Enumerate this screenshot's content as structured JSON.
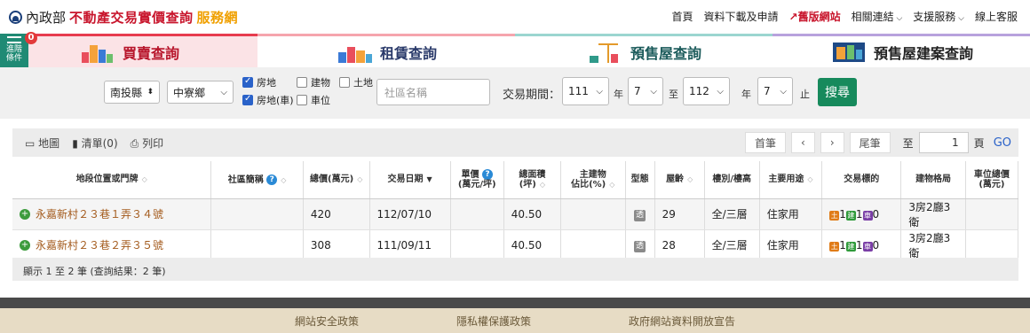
{
  "header": {
    "ministry": "內政部",
    "title": "不動產交易實價查詢",
    "title_suffix": "服務網",
    "nav": [
      "首頁",
      "資料下載及申請",
      "舊版網站",
      "相關連結",
      "支援服務",
      "線上客服"
    ]
  },
  "advanced": {
    "label_line1": "進階",
    "label_line2": "條件",
    "badge": "0"
  },
  "tabs": [
    "買賣查詢",
    "租賃查詢",
    "預售屋查詢",
    "預售屋建案查詢"
  ],
  "filters": {
    "county": "南投縣",
    "town": "中寮鄉",
    "checks": {
      "land_bld": "房地",
      "bld": "建物",
      "land": "土地",
      "land_bld_park": "房地(車)",
      "park": "車位"
    },
    "community_placeholder": "社區名稱",
    "period_label": "交易期間：",
    "from_year": "111",
    "from_month": "7",
    "to_label": "至",
    "to_year": "112",
    "to_month": "7",
    "year_unit": "年",
    "end_label": "止",
    "search": "搜尋"
  },
  "toolbar": {
    "map": "地圖",
    "list": "清單(0)",
    "print": "列印",
    "first": "首筆",
    "prev": "‹",
    "next": "›",
    "last": "尾筆",
    "to": "至",
    "page": "1",
    "page_unit": "頁",
    "go": "GO"
  },
  "columns": {
    "addr": "地段位置或門牌",
    "community": "社區簡稱",
    "total": "總價(萬元)",
    "date": "交易日期",
    "unit_l1": "單價",
    "unit_l2": "(萬元/坪)",
    "area_l1": "總面積",
    "area_l2": "(坪)",
    "main_l1": "主建物",
    "main_l2": "佔比(%)",
    "type": "型態",
    "age": "屋齡",
    "floor": "樓別/樓高",
    "use": "主要用途",
    "target": "交易標的",
    "layout": "建物格局",
    "park_l1": "車位總價",
    "park_l2": "(萬元)"
  },
  "rows": [
    {
      "addr": "永嘉新村２３巷１弄３４號",
      "community": "",
      "total": "420",
      "date": "112/07/10",
      "unit": "",
      "area": "40.50",
      "main": "",
      "age": "29",
      "floor": "全/三層",
      "use": "住家用",
      "t1": "1",
      "t2": "1",
      "t3": "0",
      "layout": "3房2廳3衛",
      "park": ""
    },
    {
      "addr": "永嘉新村２３巷２弄３５號",
      "community": "",
      "total": "308",
      "date": "111/09/11",
      "unit": "",
      "area": "40.50",
      "main": "",
      "age": "28",
      "floor": "全/三層",
      "use": "住家用",
      "t1": "1",
      "t2": "1",
      "t3": "0",
      "layout": "3房2廳3衛",
      "park": ""
    }
  ],
  "summary": "顯示 1 至 2 筆 (查詢結果：2 筆)",
  "footer": [
    "網站安全政策",
    "隱私權保護政策",
    "政府網站資料開放宣告"
  ],
  "icons": {
    "type_icon": "透",
    "tag_land": "土",
    "tag_bld": "建",
    "tag_park": "車",
    "help": "?"
  }
}
